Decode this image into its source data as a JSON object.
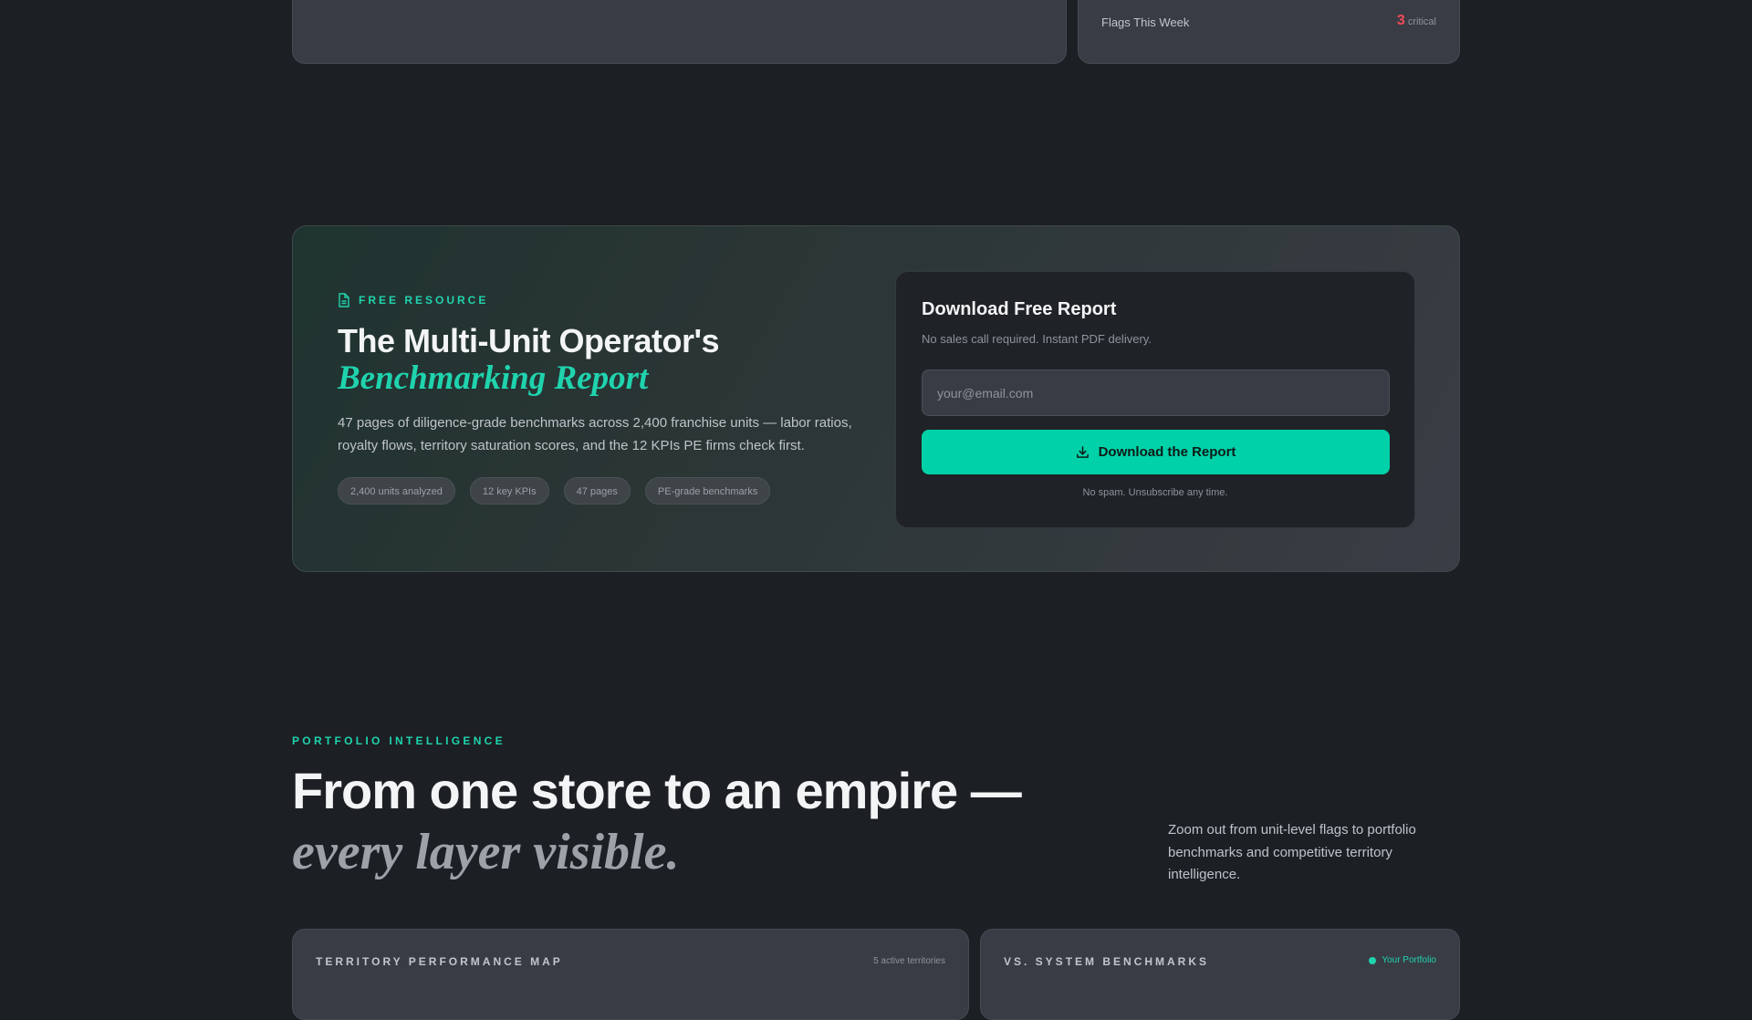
{
  "top_cards": {
    "flags_label": "Flags This Week",
    "flags_count": "3",
    "flags_unit": "critical",
    "flags_color": "#ef4b57"
  },
  "report": {
    "eyebrow_icon": "document-icon",
    "eyebrow": "FREE RESOURCE",
    "title": "The Multi-Unit Operator's",
    "title_accent": "Benchmarking Report",
    "description": "47 pages of diligence-grade benchmarks across 2,400 franchise units — labor ratios, royalty flows, territory saturation scores, and the 12 KPIs PE firms check first.",
    "tags": [
      "2,400 units analyzed",
      "12 key KPIs",
      "47 pages",
      "PE-grade benchmarks"
    ],
    "accent_color": "#1fd3ae"
  },
  "form": {
    "title": "Download Free Report",
    "subtitle": "No sales call required. Instant PDF delivery.",
    "email_placeholder": "your@email.com",
    "email_value": "",
    "button_icon": "download-icon",
    "button_label": "Download the Report",
    "button_color": "#00d1a8",
    "note": "No spam. Unsubscribe any time."
  },
  "portfolio": {
    "eyebrow": "PORTFOLIO INTELLIGENCE",
    "title": "From one store to an empire —",
    "title_accent": "every layer visible.",
    "description": "Zoom out from unit-level flags to portfolio benchmarks and competitive territory intelligence."
  },
  "panels": {
    "territory": {
      "title": "TERRITORY PERFORMANCE MAP",
      "meta": "5 active territories"
    },
    "benchmarks": {
      "title": "VS. SYSTEM BENCHMARKS",
      "legend": "Your Portfolio"
    }
  }
}
